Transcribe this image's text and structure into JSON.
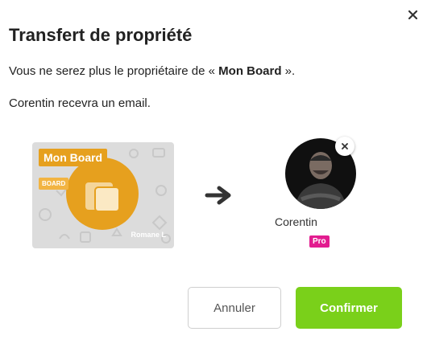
{
  "dialog": {
    "title": "Transfert de propriété",
    "line1_prefix": "Vous ne serez plus le propriétaire de « ",
    "board_name": "Mon Board",
    "line1_suffix": " ».",
    "line2": "Corentin recevra un email."
  },
  "board_card": {
    "name": "Mon Board",
    "tag": "BOARD",
    "owner": "Romane L",
    "accent_color": "#e6a01e"
  },
  "recipient": {
    "name": "Corentin",
    "badge": "Pro",
    "badge_color": "#e21c8f"
  },
  "actions": {
    "cancel_label": "Annuler",
    "confirm_label": "Confirmer",
    "confirm_color": "#7ad01a"
  },
  "icons": {
    "close": "close-icon",
    "arrow": "arrow-right-icon",
    "remove": "remove-user-icon"
  }
}
